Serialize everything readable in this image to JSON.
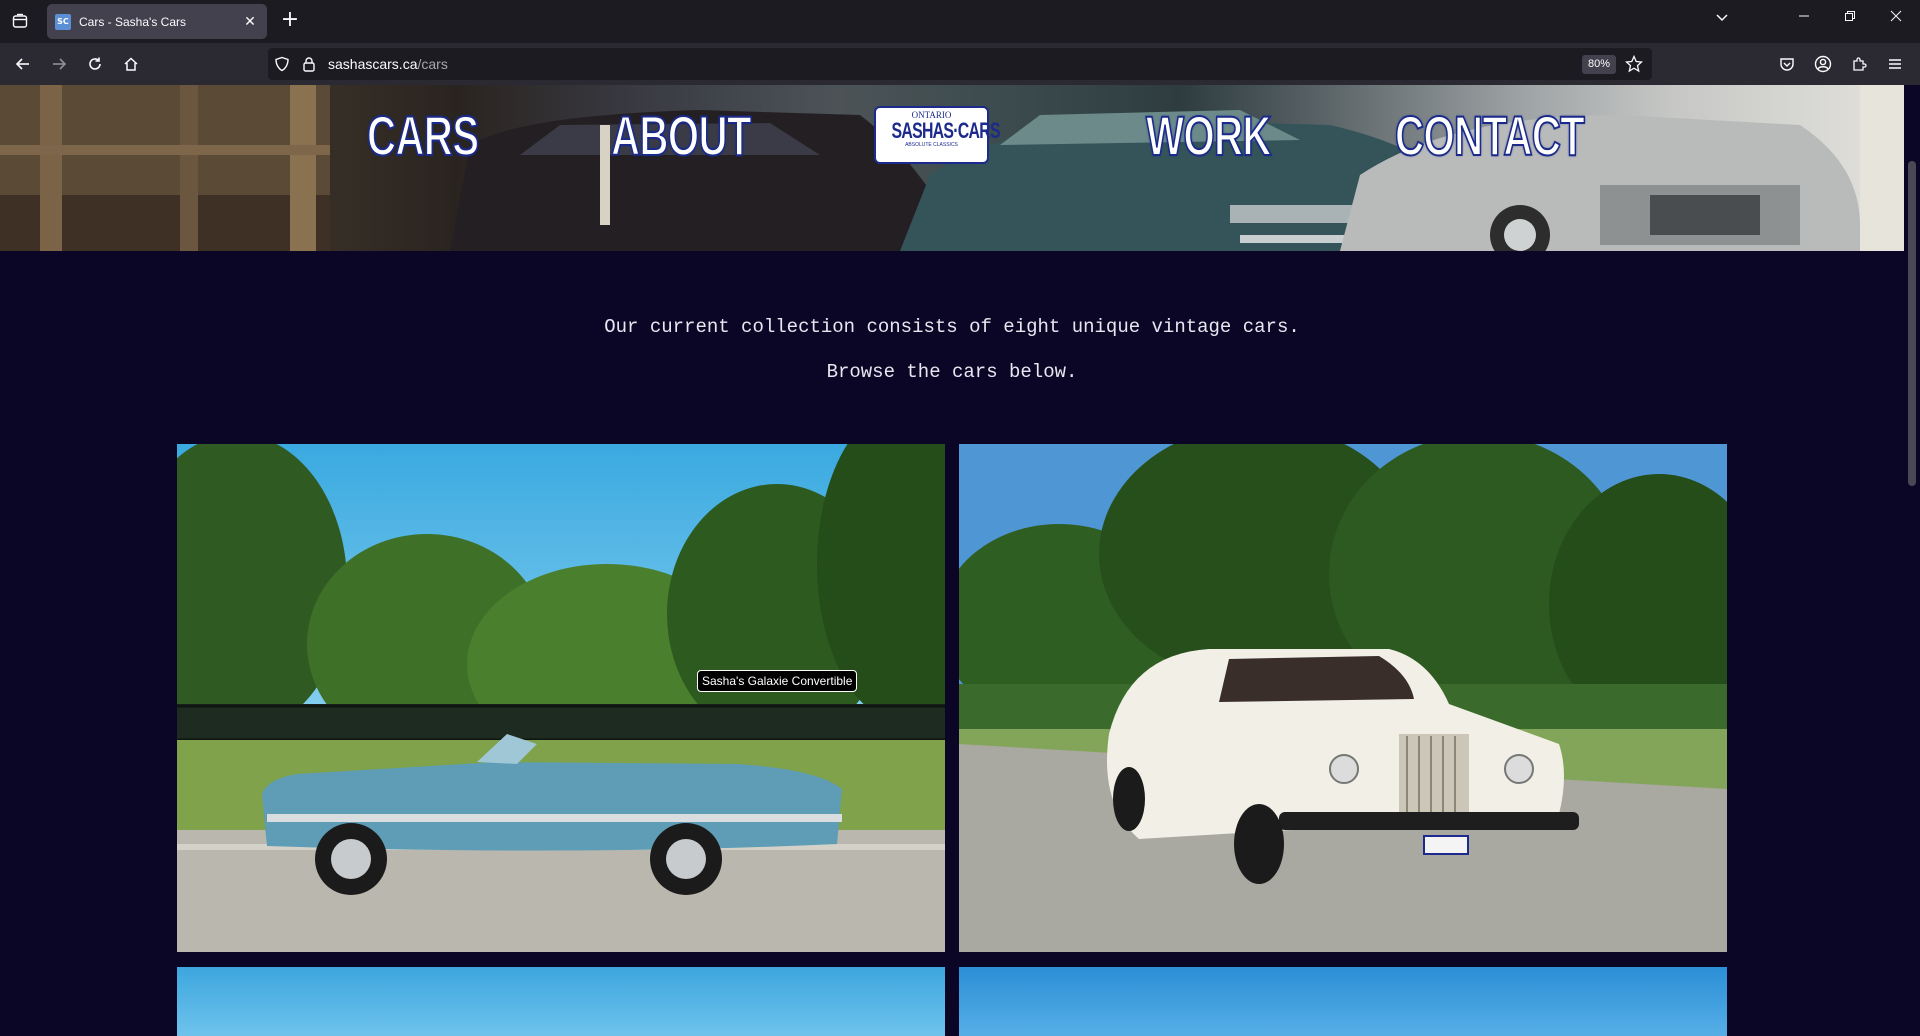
{
  "browser": {
    "tab": {
      "title": "Cars - Sasha's Cars",
      "favicon_text": "SC"
    },
    "url": {
      "domain": "sashascars.ca",
      "path": "/cars"
    },
    "zoom": "80%"
  },
  "site": {
    "nav": [
      {
        "label": "CARS"
      },
      {
        "label": "ABOUT"
      },
      {
        "label": "WORK"
      },
      {
        "label": "CONTACT"
      }
    ],
    "logo": {
      "top": "ONTARIO",
      "main": "SASHAS·CARS",
      "bottom": "ABSOLUTE CLASSICS"
    }
  },
  "intro": {
    "line1": "Our current collection consists of eight unique vintage cars.",
    "line2": "Browse the cars below."
  },
  "cars": [
    {
      "title": "Sasha's Galaxie Convertible",
      "body_color": "#5e9db5"
    },
    {
      "title": "",
      "body_color": "#f2efe6"
    }
  ],
  "tooltip": "Sasha's Galaxie Convertible",
  "colors": {
    "page_bg": "#0b0626",
    "nav_text": "#ffffff",
    "nav_outline": "#1a2a8a"
  }
}
